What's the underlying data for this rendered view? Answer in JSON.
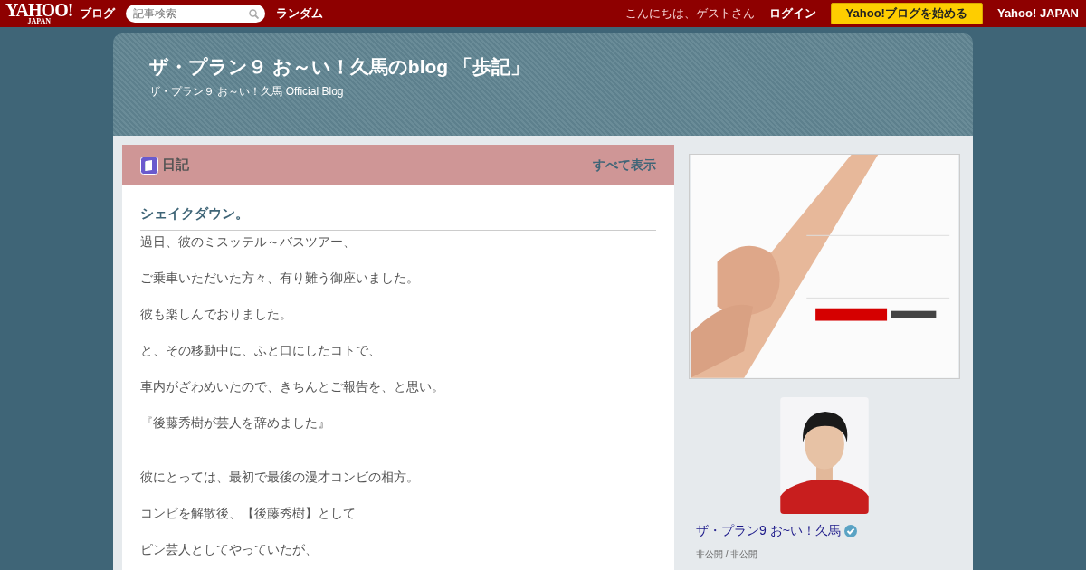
{
  "top_bar": {
    "logo": "YAHOO!",
    "logo_sub": "JAPAN",
    "service": "ブログ",
    "search": {
      "placeholder": "記事検索"
    },
    "random_link": "ランダム",
    "greeting": "こんにちは、ゲストさん",
    "login": "ログイン",
    "start_button": "Yahoo!ブログを始める",
    "home_link": "Yahoo! JAPAN"
  },
  "blog_header": {
    "title": "ザ・プラン９ お～い！久馬のblog 「歩記」",
    "subtitle": "ザ・プラン９ お～い！久馬 Official Blog"
  },
  "category": {
    "name": "日記",
    "show_all": "すべて表示"
  },
  "article": {
    "title": "シェイクダウン。",
    "sections": [
      {
        "paragraphs": [
          "過日、彼のミスッテル～バスツアー、",
          "ご乗車いただいた方々、有り難う御座いました。",
          "彼も楽しんでおりました。",
          "と、その移動中に、ふと口にしたコトで、",
          "車内がざわめいたので、きちんとご報告を、と思い。",
          "『後藤秀樹が芸人を辞めました』"
        ]
      },
      {
        "paragraphs": [
          "彼にとっては、最初で最後の漫才コンビの相方。",
          "コンビを解散後、【後藤秀樹】として",
          "ピン芸人としてやっていたが、"
        ]
      }
    ]
  },
  "sidebar": {
    "profile": {
      "name": "ザ・プラン9 お~い！久馬",
      "verified": true,
      "info": "非公開 / 非公開"
    }
  }
}
